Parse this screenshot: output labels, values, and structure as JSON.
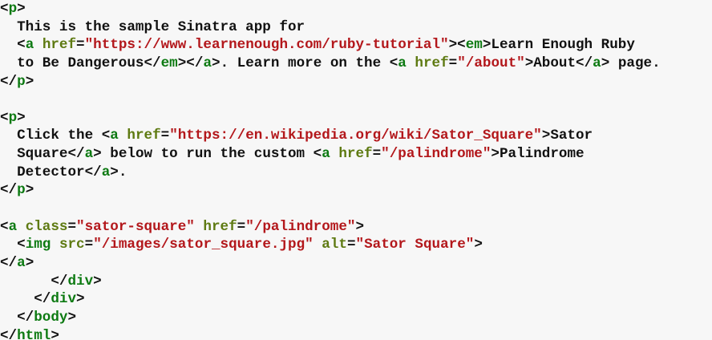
{
  "colors": {
    "background": "#f7f7f7",
    "tag": "#0d7a12",
    "attribute": "#5e7a12",
    "string": "#b3171b",
    "text": "#111111"
  },
  "code_lines": [
    [
      {
        "k": "pun",
        "t": "<"
      },
      {
        "k": "tag",
        "t": "p"
      },
      {
        "k": "pun",
        "t": ">"
      }
    ],
    [
      {
        "k": "txt",
        "t": "  This is the sample Sinatra app for"
      }
    ],
    [
      {
        "k": "txt",
        "t": "  "
      },
      {
        "k": "pun",
        "t": "<"
      },
      {
        "k": "tag",
        "t": "a"
      },
      {
        "k": "txt",
        "t": " "
      },
      {
        "k": "attr",
        "t": "href"
      },
      {
        "k": "pun",
        "t": "="
      },
      {
        "k": "str",
        "t": "\"https://www.learnenough.com/ruby-tutorial\""
      },
      {
        "k": "pun",
        "t": "><"
      },
      {
        "k": "tag",
        "t": "em"
      },
      {
        "k": "pun",
        "t": ">"
      },
      {
        "k": "txt",
        "t": "Learn Enough Ruby"
      }
    ],
    [
      {
        "k": "txt",
        "t": "  to Be Dangerous"
      },
      {
        "k": "pun",
        "t": "</"
      },
      {
        "k": "tag",
        "t": "em"
      },
      {
        "k": "pun",
        "t": "></"
      },
      {
        "k": "tag",
        "t": "a"
      },
      {
        "k": "pun",
        "t": ">"
      },
      {
        "k": "txt",
        "t": ". Learn more on the "
      },
      {
        "k": "pun",
        "t": "<"
      },
      {
        "k": "tag",
        "t": "a"
      },
      {
        "k": "txt",
        "t": " "
      },
      {
        "k": "attr",
        "t": "href"
      },
      {
        "k": "pun",
        "t": "="
      },
      {
        "k": "str",
        "t": "\"/about\""
      },
      {
        "k": "pun",
        "t": ">"
      },
      {
        "k": "txt",
        "t": "About"
      },
      {
        "k": "pun",
        "t": "</"
      },
      {
        "k": "tag",
        "t": "a"
      },
      {
        "k": "pun",
        "t": ">"
      },
      {
        "k": "txt",
        "t": " page."
      }
    ],
    [
      {
        "k": "pun",
        "t": "</"
      },
      {
        "k": "tag",
        "t": "p"
      },
      {
        "k": "pun",
        "t": ">"
      }
    ],
    [],
    [
      {
        "k": "pun",
        "t": "<"
      },
      {
        "k": "tag",
        "t": "p"
      },
      {
        "k": "pun",
        "t": ">"
      }
    ],
    [
      {
        "k": "txt",
        "t": "  Click the "
      },
      {
        "k": "pun",
        "t": "<"
      },
      {
        "k": "tag",
        "t": "a"
      },
      {
        "k": "txt",
        "t": " "
      },
      {
        "k": "attr",
        "t": "href"
      },
      {
        "k": "pun",
        "t": "="
      },
      {
        "k": "str",
        "t": "\"https://en.wikipedia.org/wiki/Sator_Square\""
      },
      {
        "k": "pun",
        "t": ">"
      },
      {
        "k": "txt",
        "t": "Sator"
      }
    ],
    [
      {
        "k": "txt",
        "t": "  Square"
      },
      {
        "k": "pun",
        "t": "</"
      },
      {
        "k": "tag",
        "t": "a"
      },
      {
        "k": "pun",
        "t": ">"
      },
      {
        "k": "txt",
        "t": " below to run the custom "
      },
      {
        "k": "pun",
        "t": "<"
      },
      {
        "k": "tag",
        "t": "a"
      },
      {
        "k": "txt",
        "t": " "
      },
      {
        "k": "attr",
        "t": "href"
      },
      {
        "k": "pun",
        "t": "="
      },
      {
        "k": "str",
        "t": "\"/palindrome\""
      },
      {
        "k": "pun",
        "t": ">"
      },
      {
        "k": "txt",
        "t": "Palindrome"
      }
    ],
    [
      {
        "k": "txt",
        "t": "  Detector"
      },
      {
        "k": "pun",
        "t": "</"
      },
      {
        "k": "tag",
        "t": "a"
      },
      {
        "k": "pun",
        "t": ">"
      },
      {
        "k": "txt",
        "t": "."
      }
    ],
    [
      {
        "k": "pun",
        "t": "</"
      },
      {
        "k": "tag",
        "t": "p"
      },
      {
        "k": "pun",
        "t": ">"
      }
    ],
    [],
    [
      {
        "k": "pun",
        "t": "<"
      },
      {
        "k": "tag",
        "t": "a"
      },
      {
        "k": "txt",
        "t": " "
      },
      {
        "k": "attr",
        "t": "class"
      },
      {
        "k": "pun",
        "t": "="
      },
      {
        "k": "str",
        "t": "\"sator-square\""
      },
      {
        "k": "txt",
        "t": " "
      },
      {
        "k": "attr",
        "t": "href"
      },
      {
        "k": "pun",
        "t": "="
      },
      {
        "k": "str",
        "t": "\"/palindrome\""
      },
      {
        "k": "pun",
        "t": ">"
      }
    ],
    [
      {
        "k": "txt",
        "t": "  "
      },
      {
        "k": "pun",
        "t": "<"
      },
      {
        "k": "tag",
        "t": "img"
      },
      {
        "k": "txt",
        "t": " "
      },
      {
        "k": "attr",
        "t": "src"
      },
      {
        "k": "pun",
        "t": "="
      },
      {
        "k": "str",
        "t": "\"/images/sator_square.jpg\""
      },
      {
        "k": "txt",
        "t": " "
      },
      {
        "k": "attr",
        "t": "alt"
      },
      {
        "k": "pun",
        "t": "="
      },
      {
        "k": "str",
        "t": "\"Sator Square\""
      },
      {
        "k": "pun",
        "t": ">"
      }
    ],
    [
      {
        "k": "pun",
        "t": "</"
      },
      {
        "k": "tag",
        "t": "a"
      },
      {
        "k": "pun",
        "t": ">"
      }
    ],
    [
      {
        "k": "txt",
        "t": "      "
      },
      {
        "k": "pun",
        "t": "</"
      },
      {
        "k": "tag",
        "t": "div"
      },
      {
        "k": "pun",
        "t": ">"
      }
    ],
    [
      {
        "k": "txt",
        "t": "    "
      },
      {
        "k": "pun",
        "t": "</"
      },
      {
        "k": "tag",
        "t": "div"
      },
      {
        "k": "pun",
        "t": ">"
      }
    ],
    [
      {
        "k": "txt",
        "t": "  "
      },
      {
        "k": "pun",
        "t": "</"
      },
      {
        "k": "tag",
        "t": "body"
      },
      {
        "k": "pun",
        "t": ">"
      }
    ],
    [
      {
        "k": "pun",
        "t": "</"
      },
      {
        "k": "tag",
        "t": "html"
      },
      {
        "k": "pun",
        "t": ">"
      }
    ]
  ]
}
